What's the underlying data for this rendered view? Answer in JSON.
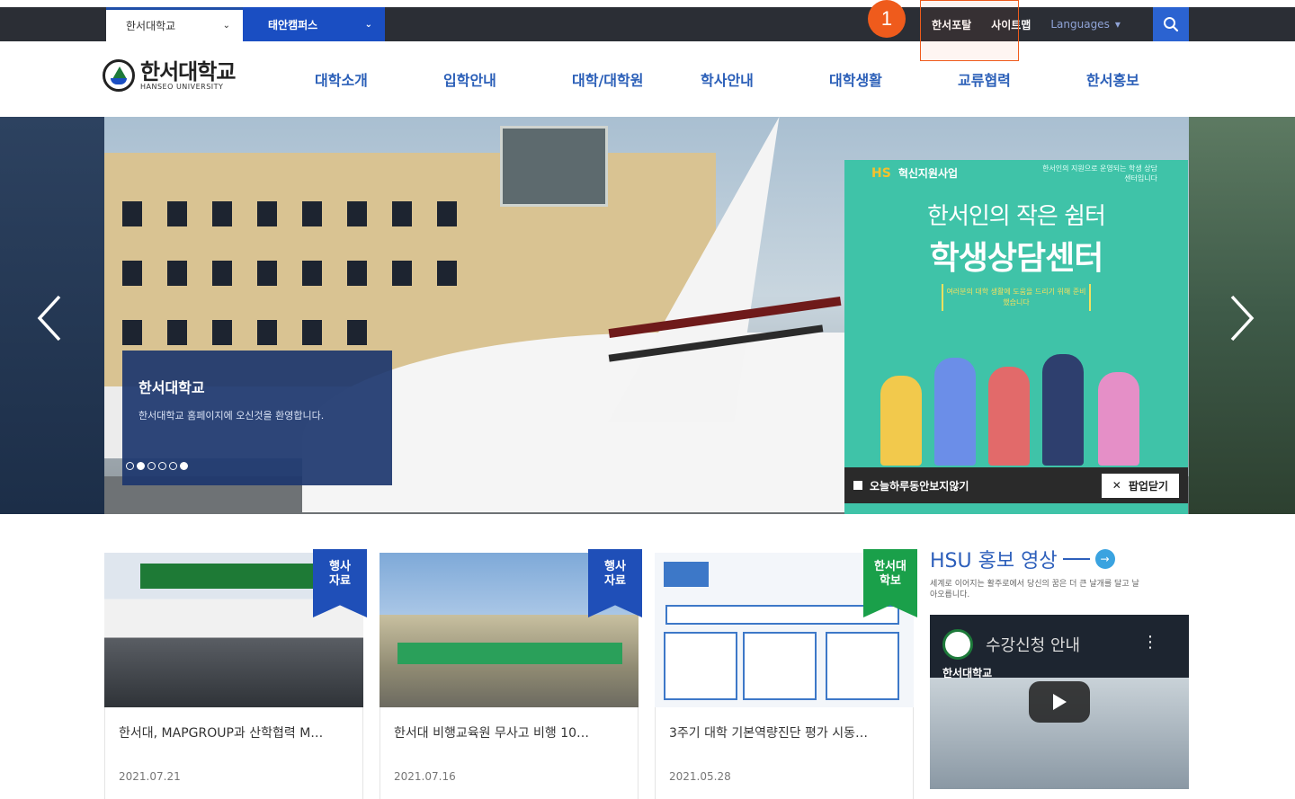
{
  "topbar": {
    "campus_label": "한서대학교",
    "campus2_label": "태안캠퍼스",
    "links": [
      "한서포탈",
      "사이트맵"
    ],
    "languages_label": "Languages",
    "annotation_number": "1"
  },
  "header": {
    "logo_kor": "한서대학교",
    "logo_eng": "HANSEO UNIVERSITY",
    "nav": [
      "대학소개",
      "입학안내",
      "대학/대학원",
      "학사안내",
      "대학생활",
      "교류협력",
      "한서홍보"
    ]
  },
  "hero": {
    "caption_title": "한서대학교",
    "caption_sub": "한서대학교 홈페이지에 오신것을 환영합니다.",
    "slide_count": 6,
    "active_slide": 2
  },
  "popup": {
    "header_logo": "HS",
    "header_label": "혁신지원사업",
    "header_right": "한서인의 지원으로 운영되는 학생 상담 센터입니다",
    "line1": "한서인의 작은 쉼터",
    "line2": "학생상담센터",
    "tag": "여러분의 대학 생활에 도움을 드리기 위해 준비했습니다",
    "checkbox_label": "오늘하루동안보지않기",
    "close_label": "팝업닫기"
  },
  "news": [
    {
      "tag": "행사\n자료",
      "title": "한서대, MAPGROUP과 산학협력 M…",
      "date": "2021.07.21"
    },
    {
      "tag": "행사\n자료",
      "title": "한서대 비행교육원 무사고 비행 10…",
      "date": "2021.07.16"
    },
    {
      "tag": "한서대\n학보",
      "title": "3주기 대학 기본역량진단 평가 시동…",
      "date": "2021.05.28"
    }
  ],
  "hsu": {
    "title": "HSU 홍보 영상",
    "sub": "세계로 이어지는 활주로에서 당신의 꿈은 더 큰 날개를 달고 날아오릅니다.",
    "video_title": "수강신청 안내",
    "video_logo_text": "한서대학교"
  },
  "colors": {
    "topbar": "#2b2e35",
    "accent_blue": "#1a4ec2",
    "nav_blue": "#2b5fb8",
    "popup_teal": "#3fc3a8",
    "annotation": "#ef5b1c",
    "tag_blue": "#1f4fb8",
    "tag_green": "#1aa04a"
  }
}
